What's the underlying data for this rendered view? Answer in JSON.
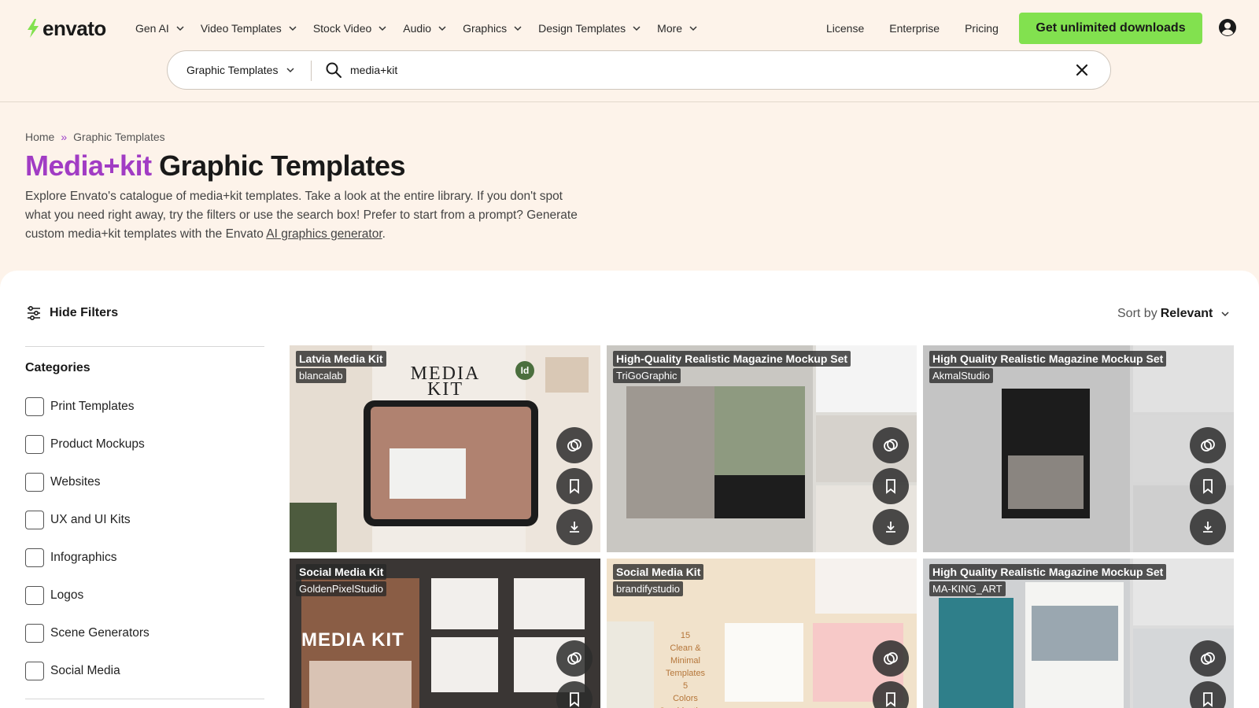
{
  "header": {
    "logo_text": "envato",
    "nav": [
      {
        "label": "Gen AI"
      },
      {
        "label": "Video Templates"
      },
      {
        "label": "Stock Video"
      },
      {
        "label": "Audio"
      },
      {
        "label": "Graphics"
      },
      {
        "label": "Design Templates"
      },
      {
        "label": "More"
      }
    ],
    "links": [
      "License",
      "Enterprise",
      "Pricing"
    ],
    "cta": "Get unlimited downloads",
    "accent_color": "#82e14f"
  },
  "search": {
    "category": "Graphic Templates",
    "query": "media+kit",
    "placeholder": "Search"
  },
  "breadcrumb": [
    "Home",
    "Graphic Templates"
  ],
  "breadcrumb_sep": "»",
  "page": {
    "title_accent": "Media+kit",
    "title_rest": " Graphic Templates",
    "intro_text": "Explore Envato's catalogue of media+kit templates. Take a look at the entire library. If you don't spot what you need right away, try the filters or use the search box! Prefer to start from a prompt? Generate custom media+kit templates with the Envato ",
    "intro_link": "AI graphics generator",
    "intro_end": ".",
    "accent_color": "#a13cc4"
  },
  "toolbar": {
    "hide_filters": "Hide Filters",
    "sort_prefix": "Sort by",
    "sort_value": "Relevant"
  },
  "filters": {
    "title": "Categories",
    "items": [
      "Print Templates",
      "Product Mockups",
      "Websites",
      "UX and UI Kits",
      "Infographics",
      "Logos",
      "Scene Generators",
      "Social Media"
    ]
  },
  "cards": [
    {
      "title": "Latvia Media Kit",
      "author": "blancalab",
      "badge": "Id"
    },
    {
      "title": "High-Quality Realistic Magazine Mockup Set",
      "author": "TriGoGraphic"
    },
    {
      "title": "High Quality Realistic Magazine Mockup Set",
      "author": "AkmalStudio"
    },
    {
      "title": "Social Media Kit",
      "author": "GoldenPixelStudio"
    },
    {
      "title": "Social Media Kit",
      "author": "brandifystudio"
    },
    {
      "title": "High Quality Realistic Magazine Mockup Set",
      "author": "MA-KING_ART"
    }
  ]
}
